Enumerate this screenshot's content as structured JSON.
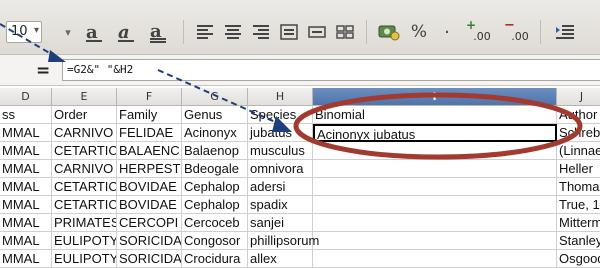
{
  "toolbar": {
    "font_size": "10",
    "icons": [
      "font-size-dropdown",
      "bold-a-icon",
      "italic-a-icon",
      "underline-a-icon",
      "align-left-icon",
      "align-center-icon",
      "align-right-icon",
      "merge-cells-icon",
      "wrap-icon",
      "grid-icon",
      "currency-icon",
      "percent-icon",
      "dot-separator-icon",
      "add-decimal-icon",
      "remove-decimal-icon"
    ],
    "percent_label": "%",
    "add_decimal_label": ".00",
    "remove_decimal_label": ".00"
  },
  "formula_bar": {
    "fx_symbol": "=",
    "content": "=G2&\" \"&H2"
  },
  "columns": [
    {
      "id": "D",
      "label": "D"
    },
    {
      "id": "E",
      "label": "E"
    },
    {
      "id": "F",
      "label": "F"
    },
    {
      "id": "G",
      "label": "G"
    },
    {
      "id": "H",
      "label": "H"
    },
    {
      "id": "I",
      "label": "I",
      "selected": true
    },
    {
      "id": "J",
      "label": "J"
    }
  ],
  "rows": [
    [
      "ss",
      "Order",
      "Family",
      "Genus",
      "Species",
      "Binomial",
      "Author"
    ],
    [
      "MMAL",
      "CARNIVO",
      "FELIDAE",
      "Acinonyx",
      "jubatus",
      "Acinonyx jubatus",
      "Schreber"
    ],
    [
      "MMAL",
      "CETARTIC",
      "BALAENC",
      "Balaenop",
      "musculus",
      "",
      "(Linnaeus"
    ],
    [
      "MMAL",
      "CARNIVO",
      "HERPEST",
      "Bdeogale",
      "omnivora",
      "",
      "Heller"
    ],
    [
      "MMAL",
      "CETARTIC",
      "BOVIDAE",
      "Cephalop",
      "adersi",
      "",
      "Thomas"
    ],
    [
      "MMAL",
      "CETARTIC",
      "BOVIDAE",
      "Cephalop",
      "spadix",
      "",
      "True, 1"
    ],
    [
      "MMAL",
      "PRIMATES",
      "CERCOPI",
      "Cercoceb",
      "sanjei",
      "",
      "Mitterm"
    ],
    [
      "MMAL",
      "EULIPOTY",
      "SORICIDA",
      "Congosor",
      "phillipsorum",
      "",
      "Stanley"
    ],
    [
      "MMAL",
      "EULIPOTY",
      "SORICIDA",
      "Crocidura",
      "allex",
      "",
      "Osgood"
    ]
  ],
  "annotation": {
    "ellipse_color": "#a33a2f",
    "arrow_color": "#1f3f7a"
  }
}
